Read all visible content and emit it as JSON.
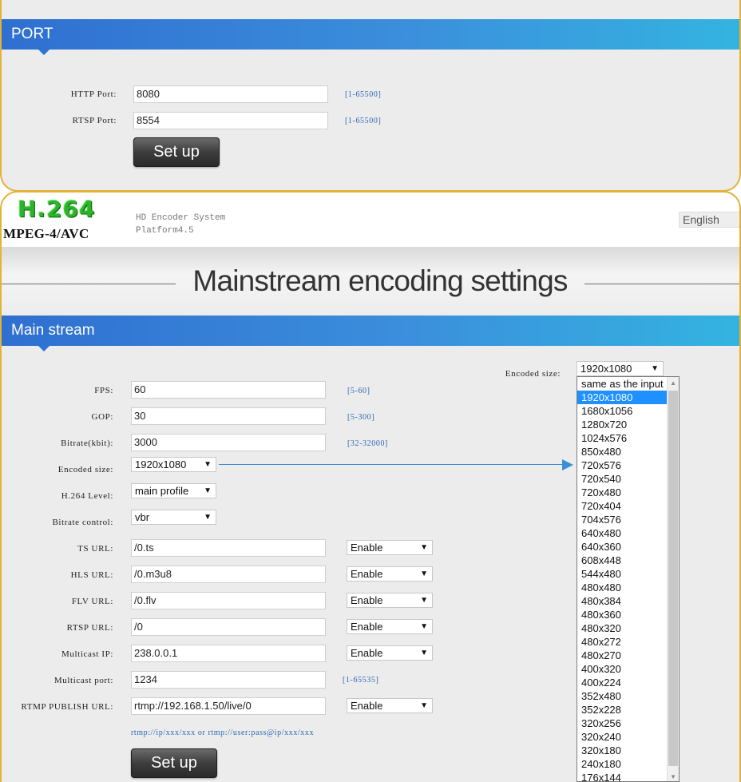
{
  "port_section": {
    "title": "PORT",
    "fields": [
      {
        "label": "HTTP Port:",
        "value": "8080",
        "hint": "[1-65500]"
      },
      {
        "label": "RTSP Port:",
        "value": "8554",
        "hint": "[1-65500]"
      }
    ],
    "setup_label": "Set up"
  },
  "header": {
    "logo_h264": "H.264",
    "logo_mpeg": "MPEG-4/AVC",
    "system_name": "HD Encoder System",
    "platform": "Platform4.5",
    "language": "English"
  },
  "page_title": "Mainstream encoding settings",
  "main_stream": {
    "title": "Main stream",
    "encoded_size_top": {
      "label": "Encoded size:",
      "value": "1920x1080"
    },
    "fields": [
      {
        "label": "FPS:",
        "value": "60",
        "hint": "[5-60]"
      },
      {
        "label": "GOP:",
        "value": "30",
        "hint": "[5-300]"
      },
      {
        "label": "Bitrate(kbit):",
        "value": "3000",
        "hint": "[32-32000]"
      }
    ],
    "selects": [
      {
        "label": "Encoded size:",
        "value": "1920x1080"
      },
      {
        "label": "H.264 Level:",
        "value": "main profile"
      },
      {
        "label": "Bitrate control:",
        "value": "vbr"
      }
    ],
    "urls": [
      {
        "label": "TS URL:",
        "value": "/0.ts",
        "state": "Enable"
      },
      {
        "label": "HLS URL:",
        "value": "/0.m3u8",
        "state": "Enable"
      },
      {
        "label": "FLV URL:",
        "value": "/0.flv",
        "state": "Enable"
      },
      {
        "label": "RTSP URL:",
        "value": "/0",
        "state": "Enable"
      },
      {
        "label": "Multicast IP:",
        "value": "238.0.0.1",
        "state": "Enable"
      }
    ],
    "multicast_port": {
      "label": "Multicast port:",
      "value": "1234",
      "hint": "[1-65535]"
    },
    "rtmp": {
      "label": "RTMP PUBLISH URL:",
      "value": "rtmp://192.168.1.50/live/0",
      "state": "Enable"
    },
    "rtmp_hint": "rtmp://ip/xxx/xxx or rtmp://user:pass@ip/xxx/xxx",
    "setup_label": "Set up"
  },
  "encoded_size_options": [
    "same as the input",
    "1920x1080",
    "1680x1056",
    "1280x720",
    "1024x576",
    "850x480",
    "720x576",
    "720x540",
    "720x480",
    "720x404",
    "704x576",
    "640x480",
    "640x360",
    "608x448",
    "544x480",
    "480x480",
    "480x384",
    "480x360",
    "480x320",
    "480x272",
    "480x270",
    "400x320",
    "400x224",
    "352x480",
    "352x228",
    "320x256",
    "320x240",
    "320x180",
    "240x180",
    "176x144"
  ],
  "encoded_size_selected_index": 1,
  "colors": {
    "accent_blue": "#3b8fdc",
    "panel_border": "#e3b23c",
    "logo_green": "#2bb52a",
    "selection": "#1e90ff"
  }
}
